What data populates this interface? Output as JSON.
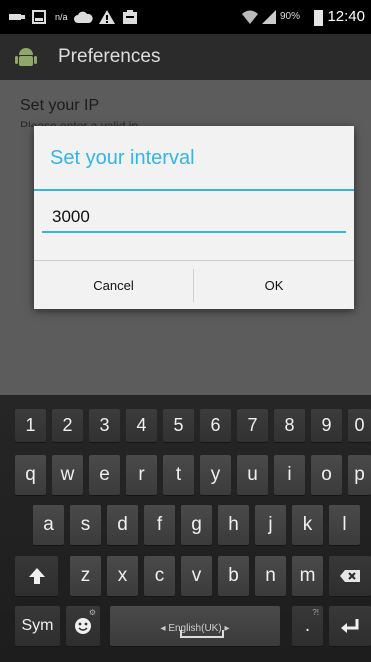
{
  "status_bar": {
    "network_label": "n/a",
    "battery_percent": "90%",
    "clock": "12:40",
    "icons": [
      "usb-icon",
      "sd-card-icon",
      "network-na-icon",
      "cloud-icon",
      "warning-icon",
      "clipboard-icon",
      "wifi-icon",
      "signal-icon",
      "battery-icon"
    ]
  },
  "action_bar": {
    "title": "Preferences",
    "app_icon": "android-icon"
  },
  "background_prefs": {
    "ip_title": "Set your IP",
    "ip_summary": "Please enter a valid ip"
  },
  "dialog": {
    "title": "Set your interval",
    "input_value": "3000",
    "cancel_label": "Cancel",
    "ok_label": "OK",
    "accent": "#33b5e5"
  },
  "keyboard": {
    "row_numbers": [
      "1",
      "2",
      "3",
      "4",
      "5",
      "6",
      "7",
      "8",
      "9",
      "0"
    ],
    "row1": [
      "q",
      "w",
      "e",
      "r",
      "t",
      "y",
      "u",
      "i",
      "o",
      "p"
    ],
    "row2": [
      "a",
      "s",
      "d",
      "f",
      "g",
      "h",
      "j",
      "k",
      "l"
    ],
    "row3": [
      "z",
      "x",
      "c",
      "v",
      "b",
      "n",
      "m"
    ],
    "sym_label": "Sym",
    "language_label": "English(UK)",
    "period_label": ".",
    "period_hint": "?!",
    "shift_icon": "shift-icon",
    "backspace_icon": "backspace-icon",
    "enter_icon": "enter-icon",
    "emoji_icon": "emoji-icon",
    "emoji_hint": "⚙"
  }
}
